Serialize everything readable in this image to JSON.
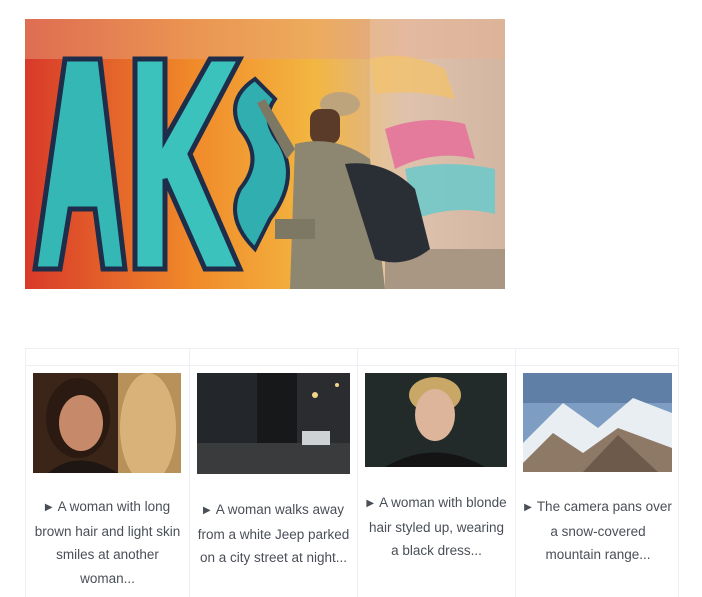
{
  "hero": {
    "alt": "Man painting graffiti wall",
    "icon": "graffiti-image"
  },
  "gallery": {
    "items": [
      {
        "icon": "play-icon",
        "caption": "A woman with long brown hair and light skin smiles at another woman..."
      },
      {
        "icon": "play-icon",
        "caption": "A woman walks away from a white Jeep parked on a city street at night..."
      },
      {
        "icon": "play-icon",
        "caption": "A woman with blonde hair styled up, wearing a black dress..."
      },
      {
        "icon": "play-icon",
        "caption": "The camera pans over a snow-covered mountain range..."
      }
    ]
  }
}
